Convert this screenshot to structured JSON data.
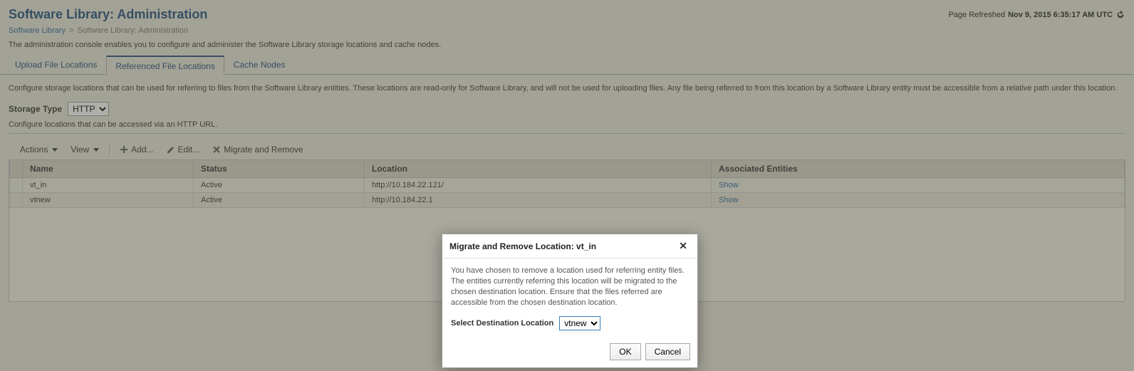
{
  "header": {
    "title": "Software Library: Administration",
    "refresh_prefix": "Page Refreshed",
    "refresh_time": "Nov 9, 2015 6:35:17 AM UTC"
  },
  "breadcrumb": {
    "root": "Software Library",
    "current": "Software Library: Administration"
  },
  "description": "The administration console enables you to configure and administer the Software Library storage locations and cache nodes.",
  "tabs": [
    {
      "label": "Upload File Locations"
    },
    {
      "label": "Referenced File Locations"
    },
    {
      "label": "Cache Nodes"
    }
  ],
  "tab_content": {
    "desc": "Configure storage locations that can be used for referring to files from the Software Library entities. These locations are read-only for Software Library, and will not be used for uploading files. Any file being referred to from this location by a Software Library entity must be accessible from a relative path under this location.",
    "storage_type_label": "Storage Type",
    "storage_type_value": "HTTP",
    "storage_type_desc": "Configure locations that can be accessed via an HTTP URL."
  },
  "toolbar": {
    "actions": "Actions",
    "view": "View",
    "add": "Add...",
    "edit": "Edit...",
    "migrate": "Migrate and Remove"
  },
  "table": {
    "headers": {
      "name": "Name",
      "status": "Status",
      "location": "Location",
      "associated": "Associated Entities"
    },
    "rows": [
      {
        "name": "vt_in",
        "status": "Active",
        "location": "http://10.184.22.121/",
        "associated": "Show"
      },
      {
        "name": "vtnew",
        "status": "Active",
        "location": "http://10.184.22.1",
        "associated": "Show"
      }
    ]
  },
  "dialog": {
    "title": "Migrate and Remove Location: vt_in",
    "body": "You have chosen to remove a location used for referring entity files. The entities currently referring this location will be migrated to the chosen destination location. Ensure that the files referred are accessible from the chosen destination location.",
    "dest_label": "Select Destination Location",
    "dest_value": "vtnew",
    "ok": "OK",
    "cancel": "Cancel"
  }
}
